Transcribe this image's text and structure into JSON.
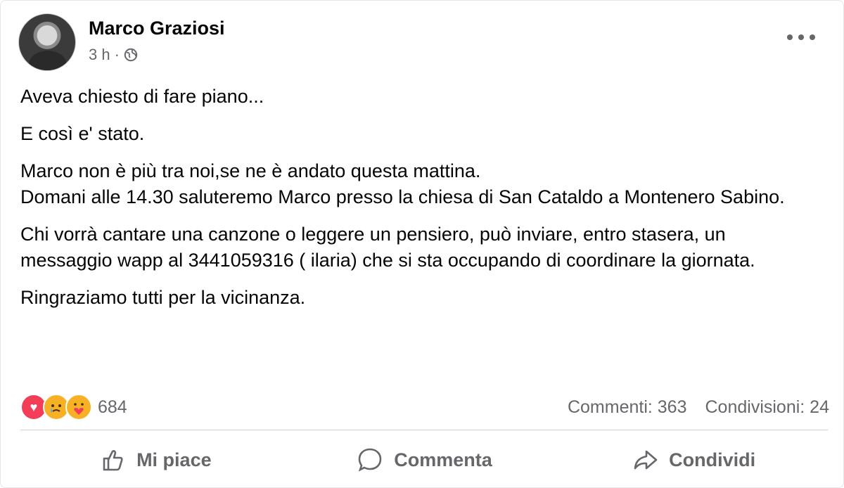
{
  "post": {
    "author": "Marco Graziosi",
    "time": "3 h",
    "separator": "·",
    "paragraphs": [
      "Aveva chiesto di fare piano...",
      "E così e' stato.",
      "Marco non è più tra noi,se ne è andato questa mattina.",
      "Domani alle 14.30 saluteremo Marco presso la chiesa di San Cataldo a Montenero Sabino.",
      "Chi vorrà cantare una canzone o leggere un pensiero, può inviare, entro stasera, un messaggio wapp al 3441059316 ( ilaria) che si sta occupando di coordinare la giornata.",
      "Ringraziamo tutti per la vicinanza."
    ]
  },
  "stats": {
    "reactions": [
      "love-icon",
      "sad-icon",
      "care-icon"
    ],
    "reaction_count": "684",
    "comments": "Commenti: 363",
    "shares": "Condivisioni: 24"
  },
  "actions": {
    "like": "Mi piace",
    "comment": "Commenta",
    "share": "Condividi"
  },
  "colors": {
    "text": "#050505",
    "secondary": "#65676b",
    "love": "#f33e58",
    "emoji": "#f7b125"
  }
}
